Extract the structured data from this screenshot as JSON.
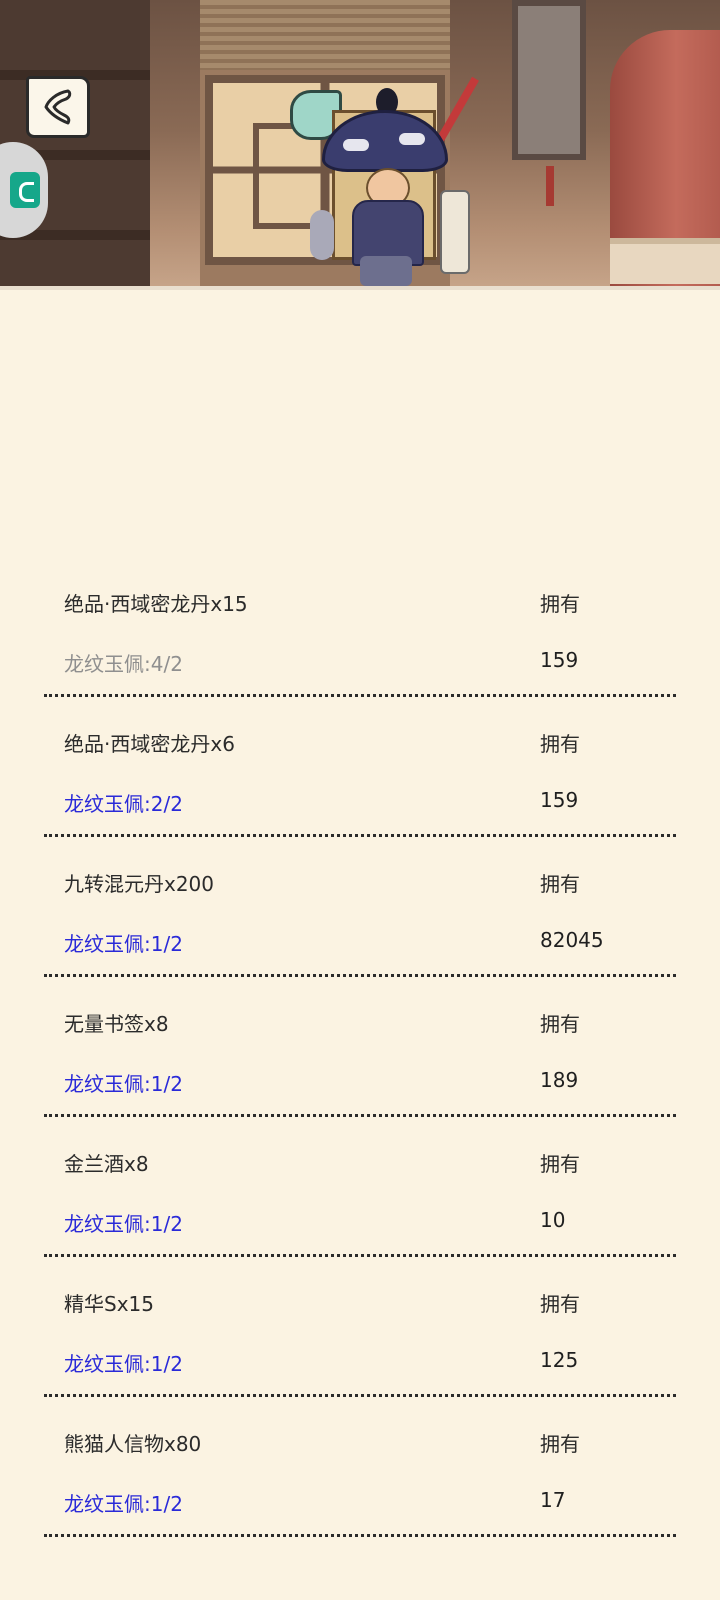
{
  "header": {
    "back_icon": "back-chevron-icon",
    "side_icon": "app-shortcut-icon"
  },
  "items": [
    {
      "name": "绝品·西域密龙丹x15",
      "requirement": "龙纹玉佩:4/2",
      "own_label": "拥有",
      "own_value": "159",
      "req_color": "#8f8f8f"
    },
    {
      "name": "绝品·西域密龙丹x6",
      "requirement": "龙纹玉佩:2/2",
      "own_label": "拥有",
      "own_value": "159",
      "req_color": "#2a2ad8"
    },
    {
      "name": "九转混元丹x200",
      "requirement": "龙纹玉佩:1/2",
      "own_label": "拥有",
      "own_value": "82045",
      "req_color": "#2a2ad8"
    },
    {
      "name": "无量书签x8",
      "requirement": "龙纹玉佩:1/2",
      "own_label": "拥有",
      "own_value": "189",
      "req_color": "#2a2ad8"
    },
    {
      "name": "金兰酒x8",
      "requirement": "龙纹玉佩:1/2",
      "own_label": "拥有",
      "own_value": "10",
      "req_color": "#2a2ad8"
    },
    {
      "name": "精华Sx15",
      "requirement": "龙纹玉佩:1/2",
      "own_label": "拥有",
      "own_value": "125",
      "req_color": "#2a2ad8"
    },
    {
      "name": "熊猫人信物x80",
      "requirement": "龙纹玉佩:1/2",
      "own_label": "拥有",
      "own_value": "17",
      "req_color": "#2a2ad8"
    }
  ]
}
